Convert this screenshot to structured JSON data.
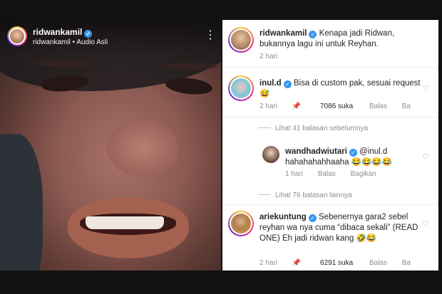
{
  "video": {
    "username": "ridwankamil",
    "subtitle": "ridwankamil • Audio Asli",
    "more_icon": "more-vert-icon"
  },
  "caption": {
    "username": "ridwankamil",
    "text": "Kenapa jadi Ridwan, bukannya lagu ini untuk Reyhan.",
    "time": "2 hari"
  },
  "comments": [
    {
      "username": "inul.d",
      "text": "Bisa di custom pak, sesuai request 😅",
      "time": "2 hari",
      "likes": "7086 suka",
      "reply": "Balas",
      "extra": "Ba"
    },
    {
      "username": "wandhadwiutari",
      "text": "@inul.d hahahahahhaaha 😂😂😂😂",
      "time": "1 hari",
      "reply": "Balas",
      "share": "Bagikan"
    },
    {
      "username": "ariekuntung",
      "text": "Sebenernya gara2 sebel reyhan wa nya cuma “dibaca sekali” (READ ONE) Eh jadi ridwan kang 🤣😂",
      "time": "2 hari",
      "likes": "6291 suka",
      "reply": "Balas",
      "extra": "Ba"
    }
  ],
  "view_previous": "Lihat 41 balasan sebelumnya",
  "view_more": "Lihat 76 balasan lainnya",
  "icons": {
    "verified": "verified-badge-icon",
    "heart": "heart-outline-icon",
    "pin": "pin-icon"
  },
  "colors": {
    "verified": "#3897f0",
    "muted_text": "#8e8e8e",
    "text": "#262626"
  }
}
